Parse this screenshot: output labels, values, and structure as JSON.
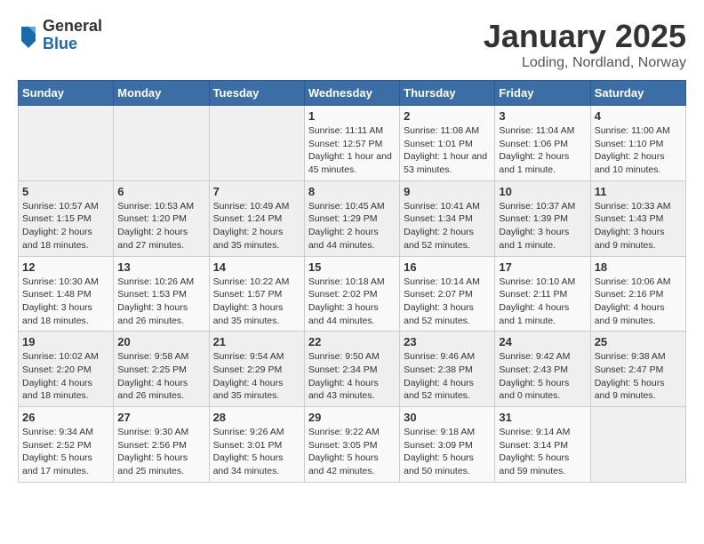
{
  "header": {
    "logo_general": "General",
    "logo_blue": "Blue",
    "month_title": "January 2025",
    "location": "Loding, Nordland, Norway"
  },
  "weekdays": [
    "Sunday",
    "Monday",
    "Tuesday",
    "Wednesday",
    "Thursday",
    "Friday",
    "Saturday"
  ],
  "weeks": [
    [
      {
        "day": "",
        "content": ""
      },
      {
        "day": "",
        "content": ""
      },
      {
        "day": "",
        "content": ""
      },
      {
        "day": "1",
        "content": "Sunrise: 11:11 AM\nSunset: 12:57 PM\nDaylight: 1 hour and 45 minutes."
      },
      {
        "day": "2",
        "content": "Sunrise: 11:08 AM\nSunset: 1:01 PM\nDaylight: 1 hour and 53 minutes."
      },
      {
        "day": "3",
        "content": "Sunrise: 11:04 AM\nSunset: 1:06 PM\nDaylight: 2 hours and 1 minute."
      },
      {
        "day": "4",
        "content": "Sunrise: 11:00 AM\nSunset: 1:10 PM\nDaylight: 2 hours and 10 minutes."
      }
    ],
    [
      {
        "day": "5",
        "content": "Sunrise: 10:57 AM\nSunset: 1:15 PM\nDaylight: 2 hours and 18 minutes."
      },
      {
        "day": "6",
        "content": "Sunrise: 10:53 AM\nSunset: 1:20 PM\nDaylight: 2 hours and 27 minutes."
      },
      {
        "day": "7",
        "content": "Sunrise: 10:49 AM\nSunset: 1:24 PM\nDaylight: 2 hours and 35 minutes."
      },
      {
        "day": "8",
        "content": "Sunrise: 10:45 AM\nSunset: 1:29 PM\nDaylight: 2 hours and 44 minutes."
      },
      {
        "day": "9",
        "content": "Sunrise: 10:41 AM\nSunset: 1:34 PM\nDaylight: 2 hours and 52 minutes."
      },
      {
        "day": "10",
        "content": "Sunrise: 10:37 AM\nSunset: 1:39 PM\nDaylight: 3 hours and 1 minute."
      },
      {
        "day": "11",
        "content": "Sunrise: 10:33 AM\nSunset: 1:43 PM\nDaylight: 3 hours and 9 minutes."
      }
    ],
    [
      {
        "day": "12",
        "content": "Sunrise: 10:30 AM\nSunset: 1:48 PM\nDaylight: 3 hours and 18 minutes."
      },
      {
        "day": "13",
        "content": "Sunrise: 10:26 AM\nSunset: 1:53 PM\nDaylight: 3 hours and 26 minutes."
      },
      {
        "day": "14",
        "content": "Sunrise: 10:22 AM\nSunset: 1:57 PM\nDaylight: 3 hours and 35 minutes."
      },
      {
        "day": "15",
        "content": "Sunrise: 10:18 AM\nSunset: 2:02 PM\nDaylight: 3 hours and 44 minutes."
      },
      {
        "day": "16",
        "content": "Sunrise: 10:14 AM\nSunset: 2:07 PM\nDaylight: 3 hours and 52 minutes."
      },
      {
        "day": "17",
        "content": "Sunrise: 10:10 AM\nSunset: 2:11 PM\nDaylight: 4 hours and 1 minute."
      },
      {
        "day": "18",
        "content": "Sunrise: 10:06 AM\nSunset: 2:16 PM\nDaylight: 4 hours and 9 minutes."
      }
    ],
    [
      {
        "day": "19",
        "content": "Sunrise: 10:02 AM\nSunset: 2:20 PM\nDaylight: 4 hours and 18 minutes."
      },
      {
        "day": "20",
        "content": "Sunrise: 9:58 AM\nSunset: 2:25 PM\nDaylight: 4 hours and 26 minutes."
      },
      {
        "day": "21",
        "content": "Sunrise: 9:54 AM\nSunset: 2:29 PM\nDaylight: 4 hours and 35 minutes."
      },
      {
        "day": "22",
        "content": "Sunrise: 9:50 AM\nSunset: 2:34 PM\nDaylight: 4 hours and 43 minutes."
      },
      {
        "day": "23",
        "content": "Sunrise: 9:46 AM\nSunset: 2:38 PM\nDaylight: 4 hours and 52 minutes."
      },
      {
        "day": "24",
        "content": "Sunrise: 9:42 AM\nSunset: 2:43 PM\nDaylight: 5 hours and 0 minutes."
      },
      {
        "day": "25",
        "content": "Sunrise: 9:38 AM\nSunset: 2:47 PM\nDaylight: 5 hours and 9 minutes."
      }
    ],
    [
      {
        "day": "26",
        "content": "Sunrise: 9:34 AM\nSunset: 2:52 PM\nDaylight: 5 hours and 17 minutes."
      },
      {
        "day": "27",
        "content": "Sunrise: 9:30 AM\nSunset: 2:56 PM\nDaylight: 5 hours and 25 minutes."
      },
      {
        "day": "28",
        "content": "Sunrise: 9:26 AM\nSunset: 3:01 PM\nDaylight: 5 hours and 34 minutes."
      },
      {
        "day": "29",
        "content": "Sunrise: 9:22 AM\nSunset: 3:05 PM\nDaylight: 5 hours and 42 minutes."
      },
      {
        "day": "30",
        "content": "Sunrise: 9:18 AM\nSunset: 3:09 PM\nDaylight: 5 hours and 50 minutes."
      },
      {
        "day": "31",
        "content": "Sunrise: 9:14 AM\nSunset: 3:14 PM\nDaylight: 5 hours and 59 minutes."
      },
      {
        "day": "",
        "content": ""
      }
    ]
  ]
}
